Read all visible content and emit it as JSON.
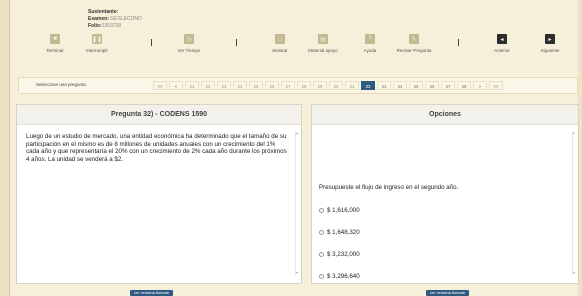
{
  "info": {
    "sustentante_label": "Sustentante:",
    "examen_label": "Examen:",
    "examen_value": "GESLECONO",
    "folio_label": "Folio:",
    "folio_value": "1303728"
  },
  "toolbar": {
    "items": [
      {
        "label": "Terminar",
        "icon": "stop-icon"
      },
      {
        "label": "Interrumpir",
        "icon": "pause-icon"
      },
      {
        "label": "Ver Tiempo",
        "icon": "clock-icon"
      },
      {
        "label": "Mostrar",
        "icon": "monitor-icon"
      },
      {
        "label": "Material apoyo",
        "icon": "document-icon"
      },
      {
        "label": "Ayuda",
        "icon": "help-icon"
      },
      {
        "label": "Revisar Pregunta",
        "icon": "edit-icon"
      },
      {
        "label": "Anterior",
        "icon": "previous-icon"
      },
      {
        "label": "Siguiente",
        "icon": "next-icon"
      }
    ]
  },
  "qnav": {
    "label": "Seleccione una pregunta",
    "pages": [
      "<<",
      "<",
      "21",
      "22",
      "23",
      "24",
      "25",
      "26",
      "27",
      "28",
      "29",
      "30",
      "31",
      "32",
      "33",
      "34",
      "35",
      "36",
      "37",
      "38",
      ">",
      ">>"
    ],
    "active": "32"
  },
  "question_panel": {
    "title": "Pregunta 32) - CODENS 1590",
    "text": "Luego de un estudio de mercado, una entidad económica ha determinado que el tamaño de su participación en el mismo es de 8 millones de unidades anuales con un crecimiento del 1% cada año y que representaría el 20% con un crecimiento de  2% cada año durante los próximos 4 años. La unidad se venderá a $2."
  },
  "options_panel": {
    "title": "Opciones",
    "prompt": "Presupueste el flujo de ingreso en el segundo año.",
    "options": [
      "$ 1,616,000",
      "$ 1,648,320",
      "$ 3,232,000",
      "$ 3,296,640"
    ]
  },
  "floating": {
    "left_label": "ver ventana flotante",
    "right_label": "ver ventana flotante"
  },
  "colors": {
    "background": "#f6efd9",
    "active_page": "#2f5b80",
    "dark_button": "#2d2d2d"
  }
}
